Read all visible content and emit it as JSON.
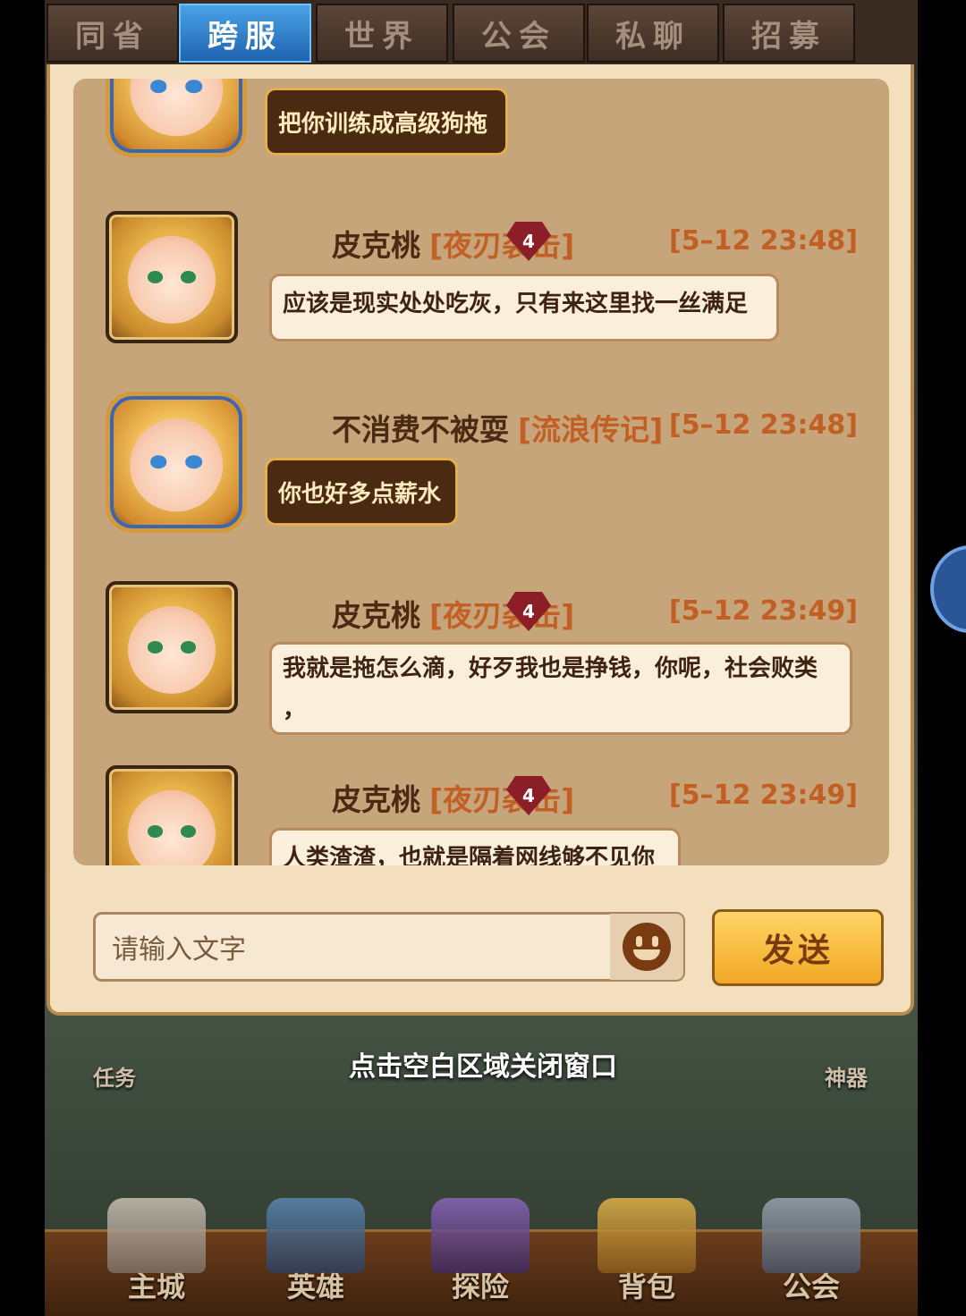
{
  "tabs": [
    {
      "label": "同省",
      "active": false
    },
    {
      "label": "跨服",
      "active": true
    },
    {
      "label": "世界",
      "active": false
    },
    {
      "label": "公会",
      "active": false
    },
    {
      "label": "私聊",
      "active": false
    },
    {
      "label": "招募",
      "active": false
    }
  ],
  "messages": [
    {
      "style": "dark",
      "text": "把你训练成高级狗拖"
    },
    {
      "name": "皮克桃",
      "guild": "[夜刃袭击]",
      "vip": "4",
      "time": "[5–12 23:48]",
      "style": "light",
      "text": "应该是现实处处吃灰，只有来这里找一丝满足"
    },
    {
      "name": "不消费不被耍",
      "guild": "[流浪传记]",
      "time": "[5–12 23:48]",
      "style": "dark",
      "text": "你也好多点薪水"
    },
    {
      "name": "皮克桃",
      "guild": "[夜刃袭击]",
      "vip": "4",
      "time": "[5–12 23:49]",
      "style": "light",
      "text": "我就是拖怎么滴，好歹我也是挣钱，你呢，社会败类",
      "text2": "，"
    },
    {
      "name": "皮克桃",
      "guild": "[夜刃袭击]",
      "vip": "4",
      "time": "[5–12 23:49]",
      "style": "light",
      "text": "人类渣渣，也就是隔着网线够不见你"
    }
  ],
  "input": {
    "placeholder": "请输入文字"
  },
  "send_label": "发送",
  "close_hint": "点击空白区域关闭窗口",
  "side": {
    "left_label": "任务",
    "right_label": "神器"
  },
  "bottom_nav": [
    "主城",
    "英雄",
    "探险",
    "背包",
    "公会"
  ]
}
